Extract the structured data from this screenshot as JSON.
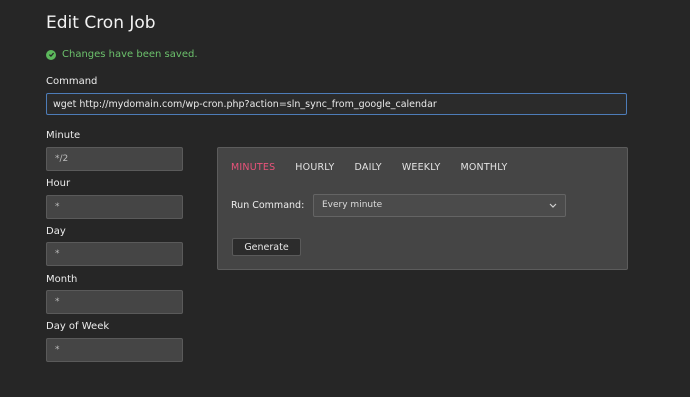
{
  "page": {
    "title": "Edit Cron Job"
  },
  "status": {
    "message": "Changes have been saved.",
    "color": "#5cb85c"
  },
  "command": {
    "label": "Command",
    "value": "wget http://mydomain.com/wp-cron.php?action=sln_sync_from_google_calendar"
  },
  "fields": {
    "minute": {
      "label": "Minute",
      "value": "*/2"
    },
    "hour": {
      "label": "Hour",
      "value": "*"
    },
    "day": {
      "label": "Day",
      "value": "*"
    },
    "month": {
      "label": "Month",
      "value": "*"
    },
    "day_of_week": {
      "label": "Day of Week",
      "value": "*"
    }
  },
  "generator": {
    "tabs": [
      "MINUTES",
      "HOURLY",
      "DAILY",
      "WEEKLY",
      "MONTHLY"
    ],
    "active_tab": "MINUTES",
    "active_color": "#e8537a",
    "run_label": "Run Command:",
    "run_value": "Every minute",
    "generate_label": "Generate"
  },
  "icons": {
    "status": "check-circle-icon",
    "select": "chevron-down-icon"
  }
}
